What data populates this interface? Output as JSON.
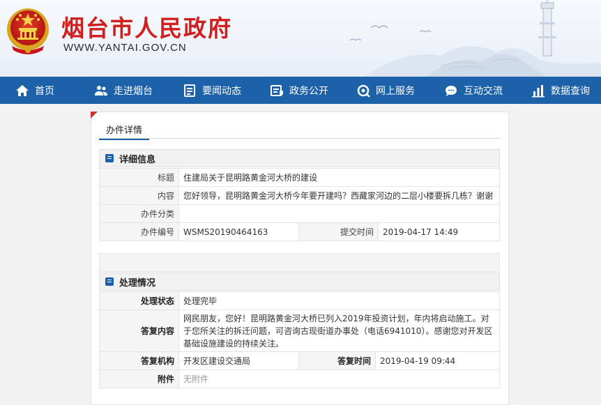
{
  "header": {
    "site_title": "烟台市人民政府",
    "site_url": "WWW.YANTAI.GOV.CN"
  },
  "nav": {
    "items": [
      {
        "label": "首页",
        "icon": "home-icon"
      },
      {
        "label": "走进烟台",
        "icon": "user-group-icon"
      },
      {
        "label": "要闻动态",
        "icon": "news-icon"
      },
      {
        "label": "政务公开",
        "icon": "file-icon"
      },
      {
        "label": "网上服务",
        "icon": "service-icon"
      },
      {
        "label": "互动交流",
        "icon": "chat-icon"
      },
      {
        "label": "数据查询",
        "icon": "chart-icon"
      }
    ]
  },
  "page": {
    "tab_title": "办件详情"
  },
  "details": {
    "section_title": "详细信息",
    "title_label": "标题",
    "title_value": "住建局关于昆明路黄金河大桥的建设",
    "content_label": "内容",
    "content_value": "您好领导，昆明路黄金河大桥今年要开建吗？西藏家河边的二层小楼要拆几栋？谢谢",
    "category_label": "办件分类",
    "category_value": "",
    "number_label": "办件编号",
    "number_value": "WSMS20190464163",
    "submit_time_label": "提交时间",
    "submit_time_value": "2019-04-17 14:49"
  },
  "processing": {
    "section_title": "处理情况",
    "status_label": "处理状态",
    "status_value": "处理完毕",
    "reply_label": "答复内容",
    "reply_value": "网民朋友，您好！昆明路黄金河大桥已列入2019年投资计划，年内将启动施工。对于您所关注的拆迁问题，可咨询古现街道办事处（电话6941010）。感谢您对开发区基础设施建设的持续关注。",
    "org_label": "答复机构",
    "org_value": "开发区建设交通局",
    "reply_time_label": "答复时间",
    "reply_time_value": "2019-04-19 09:44",
    "attachment_label": "附件",
    "attachment_value": "无附件"
  },
  "colors": {
    "brand_red": "#d11f1f",
    "nav_blue": "#1d62a9"
  }
}
